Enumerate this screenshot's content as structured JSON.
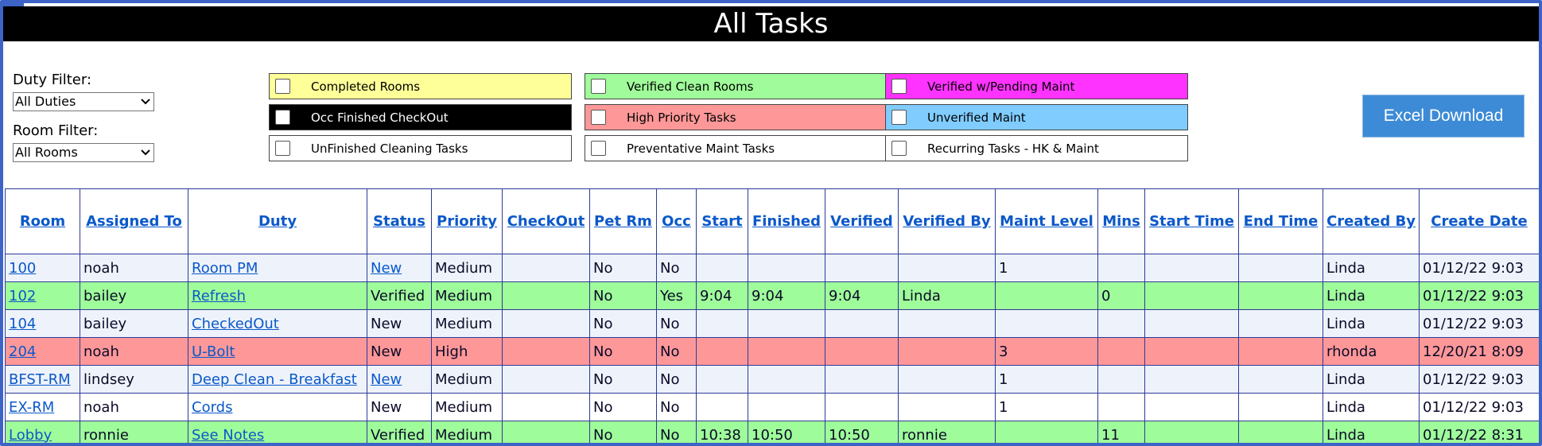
{
  "title": "All Tasks",
  "filters": {
    "duty_label": "Duty Filter:",
    "duty_value": "All Duties",
    "room_label": "Room Filter:",
    "room_value": "All Rooms"
  },
  "legend": [
    {
      "label": "Completed Rooms",
      "color": "#ffff99"
    },
    {
      "label": "Verified Clean Rooms",
      "color": "#a0fc9a"
    },
    {
      "label": "Verified w/Pending Maint",
      "color": "#ff33ff"
    },
    {
      "label": "Occ Finished CheckOut",
      "color": "#000000"
    },
    {
      "label": "High Priority Tasks",
      "color": "#fe9898"
    },
    {
      "label": "Unverified Maint",
      "color": "#80ccff"
    },
    {
      "label": "UnFinished Cleaning Tasks",
      "color": "#ffffff"
    },
    {
      "label": "Preventative Maint Tasks",
      "color": "#ffffff"
    },
    {
      "label": "Recurring Tasks - HK & Maint",
      "color": "#ffffff"
    }
  ],
  "excel_button": "Excel Download",
  "table": {
    "headers": [
      "Room",
      "Assigned To",
      "Duty",
      "Status",
      "Priority",
      "CheckOut",
      "Pet Rm",
      "Occ",
      "Start",
      "Finished",
      "Verified",
      "Verified By",
      "Maint Level",
      "Mins",
      "Start Time",
      "End Time",
      "Created By",
      "Create Date"
    ],
    "rows": [
      {
        "row_class": "c-new",
        "status_link": true,
        "cells": [
          "100",
          "noah",
          "Room PM",
          "New",
          "Medium",
          "",
          "No",
          "No",
          "",
          "",
          "",
          "",
          "1",
          "",
          "",
          "",
          "Linda",
          "01/12/22 9:03"
        ]
      },
      {
        "row_class": "c-verified",
        "status_link": false,
        "cells": [
          "102",
          "bailey",
          "Refresh",
          "Verified",
          "Medium",
          "",
          "No",
          "Yes",
          "9:04",
          "9:04",
          "9:04",
          "Linda",
          "",
          "0",
          "",
          "",
          "Linda",
          "01/12/22 9:03"
        ]
      },
      {
        "row_class": "c-new",
        "status_link": false,
        "cells": [
          "104",
          "bailey",
          "CheckedOut",
          "New",
          "Medium",
          "",
          "No",
          "No",
          "",
          "",
          "",
          "",
          "",
          "",
          "",
          "",
          "Linda",
          "01/12/22 9:03"
        ]
      },
      {
        "row_class": "c-high",
        "status_link": false,
        "cells": [
          "204",
          "noah",
          "U-Bolt",
          "New",
          "High",
          "",
          "No",
          "No",
          "",
          "",
          "",
          "",
          "3",
          "",
          "",
          "",
          "rhonda",
          "12/20/21 8:09"
        ]
      },
      {
        "row_class": "c-new",
        "status_link": true,
        "cells": [
          "BFST-RM",
          "lindsey",
          "Deep Clean - Breakfast",
          "New",
          "Medium",
          "",
          "No",
          "No",
          "",
          "",
          "",
          "",
          "1",
          "",
          "",
          "",
          "Linda",
          "01/12/22 9:03"
        ]
      },
      {
        "row_class": "c-white",
        "status_link": false,
        "cells": [
          "EX-RM",
          "noah",
          "Cords",
          "New",
          "Medium",
          "",
          "No",
          "No",
          "",
          "",
          "",
          "",
          "1",
          "",
          "",
          "",
          "Linda",
          "01/12/22 9:03"
        ]
      },
      {
        "row_class": "c-verified",
        "status_link": false,
        "cells": [
          "Lobby",
          "ronnie",
          "See Notes",
          "Verified",
          "Medium",
          "",
          "No",
          "No",
          "10:38",
          "10:50",
          "10:50",
          "ronnie",
          "",
          "11",
          "",
          "",
          "Linda",
          "01/12/22 8:31"
        ]
      }
    ]
  }
}
